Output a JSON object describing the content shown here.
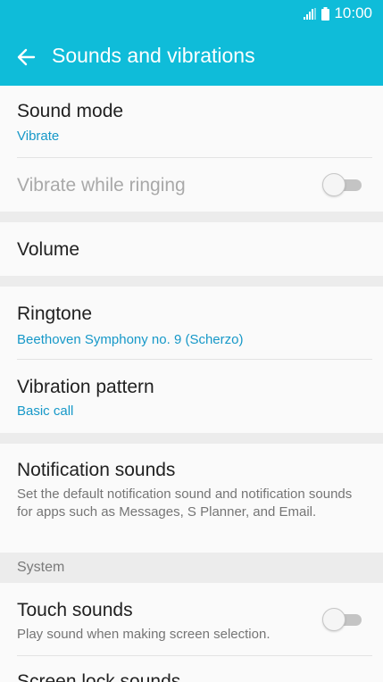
{
  "status_bar": {
    "time": "10:00"
  },
  "app_bar": {
    "title": "Sounds and vibrations"
  },
  "settings": {
    "sound_mode": {
      "title": "Sound mode",
      "value": "Vibrate"
    },
    "vibrate_while_ringing": {
      "title": "Vibrate while ringing",
      "enabled": false,
      "on": false
    },
    "volume": {
      "title": "Volume"
    },
    "ringtone": {
      "title": "Ringtone",
      "value": "Beethoven Symphony no. 9 (Scherzo)"
    },
    "vibration_pattern": {
      "title": "Vibration pattern",
      "value": "Basic call"
    },
    "notification_sounds": {
      "title": "Notification sounds",
      "description": "Set the default notification sound and notification sounds for apps such as Messages, S Planner, and Email."
    },
    "system_section": {
      "header": "System"
    },
    "touch_sounds": {
      "title": "Touch sounds",
      "description": "Play sound when making screen selection.",
      "on": false
    },
    "screen_lock_sounds": {
      "title": "Screen lock sounds"
    }
  },
  "colors": {
    "accent": "#0fbcd9",
    "link_text": "#1698c8"
  }
}
